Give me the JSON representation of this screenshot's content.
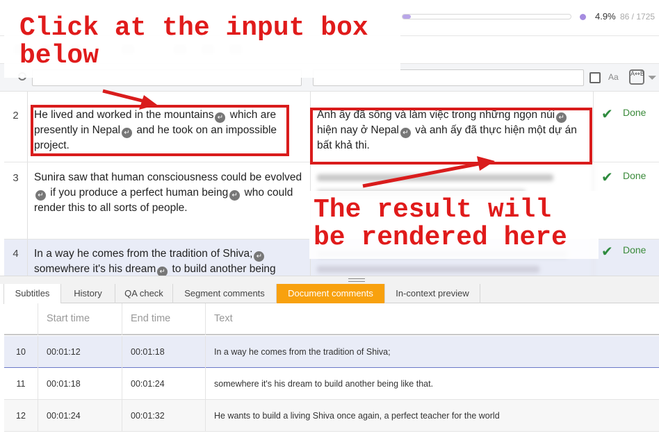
{
  "app": {
    "progress": {
      "percent_label": "4.9%",
      "fraction": 0.049,
      "count_label": "86 / 1725"
    }
  },
  "filter": {
    "case_label": "Aa",
    "regex_label": "A↔B"
  },
  "segments": [
    {
      "num": "2",
      "source": [
        "He lived and worked in the mountains",
        " which are presently in Nepal",
        " and he took on an impossible project."
      ],
      "target": [
        "Anh ấy đã sống và làm việc trong những ngọn núi",
        " hiện nay ở Nepal",
        " và anh ấy đã thực hiện một dự án bất khả thi."
      ],
      "status": "Done"
    },
    {
      "num": "3",
      "source": [
        "Sunira saw that human consciousness could be evolved",
        " if you produce a perfect human being",
        " who could render this to all sorts of people."
      ],
      "status": "Done"
    },
    {
      "num": "4",
      "source": [
        "In a way he comes from the tradition of Shiva;",
        " somewhere it's his dream",
        " to build  another being"
      ],
      "status": "Done"
    }
  ],
  "tabs": [
    {
      "label": "Subtitles"
    },
    {
      "label": "History"
    },
    {
      "label": "QA check"
    },
    {
      "label": "Segment comments"
    },
    {
      "label": "Document comments"
    },
    {
      "label": "In-context preview"
    }
  ],
  "subtitles": {
    "headers": {
      "start": "Start time",
      "end": "End time",
      "text": "Text"
    },
    "rows": [
      {
        "idx": "10",
        "start": "00:01:12",
        "end": "00:01:18",
        "text": "In a way he comes from the tradition of Shiva;"
      },
      {
        "idx": "11",
        "start": "00:01:18",
        "end": "00:01:24",
        "text": "somewhere it's his dream to build another being like that."
      },
      {
        "idx": "12",
        "start": "00:01:24",
        "end": "00:01:32",
        "text": "He wants to build a living Shiva once again, a perfect teacher for the world"
      }
    ]
  },
  "annotations": {
    "click_text": "Click at the input box\nbelow",
    "result_text": "The result will\nbe rendered here",
    "color": "#e01b1b"
  },
  "icons": {
    "paragraph_mark": "↵",
    "done_check": "✔",
    "filter": "⏷"
  }
}
